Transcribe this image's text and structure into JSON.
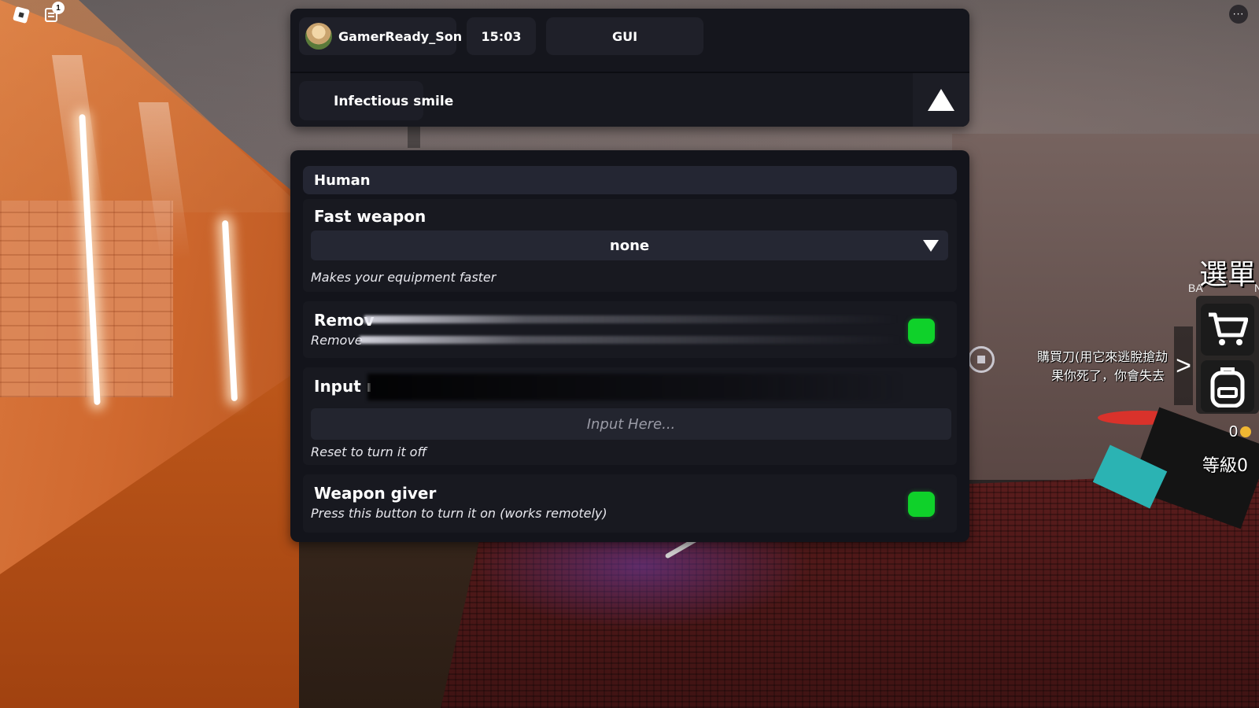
{
  "hud": {
    "chat_badge_count": "1",
    "more_glyph": "···"
  },
  "gui_header": {
    "username": "GamerReady_Son",
    "time": "15:03",
    "gui_label": "GUI",
    "tab_label": "Infectious smile"
  },
  "section": {
    "title": "Human",
    "items": [
      {
        "title": "Fast weapon",
        "dropdown_value": "none",
        "description": "Makes your equipment faster"
      },
      {
        "title": "Remov",
        "description": "Remove",
        "toggle_on": true
      },
      {
        "title": "Input ı",
        "input_placeholder": "Input Here...",
        "input_value": "",
        "description": "Reset to turn it off"
      },
      {
        "title": "Weapon giver",
        "description": "Press this button to turn it on (works remotely)",
        "toggle_on": true
      }
    ]
  },
  "game_ui": {
    "menu_label": "選單",
    "ba_label": "BA",
    "n_label": "N",
    "hint_line1": "購買刀(用它來逃脫搶劫",
    "hint_line2": "果你死了，你會失去",
    "coins": "0",
    "level": "等級0",
    "expand_glyph": ">"
  },
  "colors": {
    "panel_bg": "#13141b",
    "toggle_on": "#0fd12a",
    "header_bg": "#242633"
  },
  "icons": [
    "roblox-menu-icon",
    "chat-icon",
    "more-icon",
    "avatar",
    "collapse-triangle-icon",
    "dropdown-triangle-icon",
    "cart-icon",
    "backpack-icon",
    "robux-icon"
  ]
}
